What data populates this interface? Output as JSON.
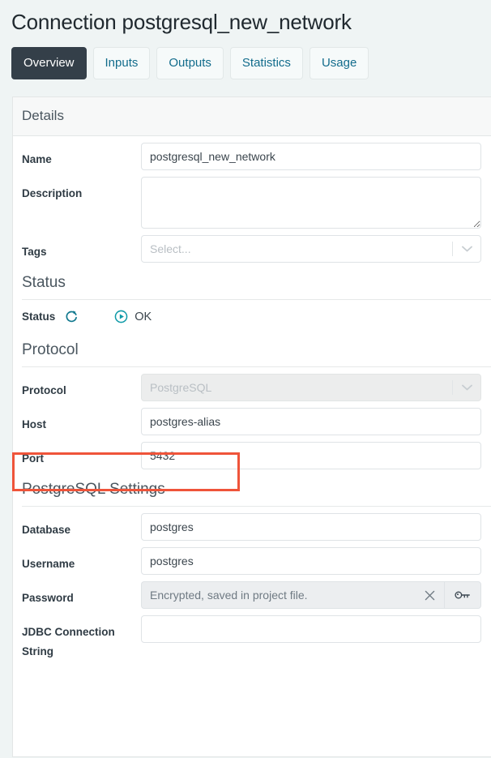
{
  "page": {
    "title": "Connection postgresql_new_network"
  },
  "tabs": [
    {
      "label": "Overview",
      "active": true
    },
    {
      "label": "Inputs",
      "active": false
    },
    {
      "label": "Outputs",
      "active": false
    },
    {
      "label": "Statistics",
      "active": false
    },
    {
      "label": "Usage",
      "active": false
    }
  ],
  "details": {
    "header": "Details",
    "name": {
      "label": "Name",
      "value": "postgresql_new_network"
    },
    "description": {
      "label": "Description",
      "value": ""
    },
    "tags": {
      "label": "Tags",
      "placeholder": "Select...",
      "value": ""
    }
  },
  "status_section": {
    "heading": "Status",
    "label": "Status",
    "refresh_icon": "refresh-icon",
    "state_icon": "play-circle-icon",
    "state_text": "OK"
  },
  "protocol_section": {
    "heading": "Protocol",
    "protocol": {
      "label": "Protocol",
      "value": "PostgreSQL",
      "disabled": true
    },
    "host": {
      "label": "Host",
      "value": "postgres-alias"
    },
    "port": {
      "label": "Port",
      "value": "5432"
    }
  },
  "postgres_settings": {
    "heading": "PostgreSQL Settings",
    "database": {
      "label": "Database",
      "value": "postgres"
    },
    "username": {
      "label": "Username",
      "value": "postgres"
    },
    "password": {
      "label": "Password",
      "value": "Encrypted, saved in project file.",
      "clear_icon": "close-icon",
      "key_icon": "key-icon"
    },
    "jdbc": {
      "label": "JDBC Connection String",
      "value": ""
    }
  },
  "colors": {
    "page_background": "#eff4f4",
    "active_tab": "#343f49",
    "tab_text": "#126c8c",
    "status_teal": "#0f9aa8",
    "refresh_teal": "#12798f",
    "highlight_red": "#ef543a"
  }
}
